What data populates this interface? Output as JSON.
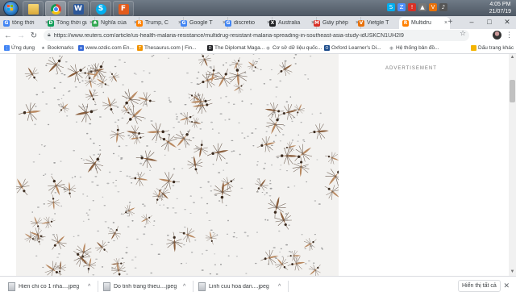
{
  "taskbar": {
    "apps": [
      {
        "icon": "folder-icon",
        "label": ""
      },
      {
        "icon": "chrome-icon",
        "label": ""
      },
      {
        "icon": "word-icon",
        "label": "W"
      },
      {
        "icon": "skype-icon",
        "label": "S"
      },
      {
        "icon": "foxit-reader-icon",
        "label": "F"
      }
    ],
    "clock": {
      "time": "4:05 PM",
      "date": "21/07/19"
    }
  },
  "tabs": [
    {
      "label": "tổng thời",
      "favicon": "translate",
      "color": "#4285f4",
      "active": false
    },
    {
      "label": "Tổng thời gian",
      "favicon": "doc",
      "color": "#0f9d58",
      "active": false
    },
    {
      "label": "Nghĩa của",
      "favicon": "leaf",
      "color": "#34a853",
      "active": false
    },
    {
      "label": "Trump, C",
      "favicon": "reuters",
      "color": "#ff8000",
      "active": false
    },
    {
      "label": "Google T",
      "favicon": "translate",
      "color": "#4285f4",
      "active": false
    },
    {
      "label": "discretio",
      "favicon": "google",
      "color": "#4285f4",
      "active": false
    },
    {
      "label": "Australia",
      "favicon": "x",
      "color": "#202124",
      "active": false
    },
    {
      "label": "Giấy phép",
      "favicon": "gmail",
      "color": "#d93025",
      "active": false
    },
    {
      "label": "Vietgle T",
      "favicon": "v",
      "color": "#e8710a",
      "active": false
    },
    {
      "label": "Multidru",
      "favicon": "reuters",
      "color": "#ff8000",
      "active": true
    }
  ],
  "address_bar": {
    "url": "https://www.reuters.com/article/us-health-malaria-resistance/multidrug-resistant-malaria-spreading-in-southeast-asia-study-idUSKCN1UH2I9"
  },
  "bookmarks": [
    {
      "label": "Ứng dụng",
      "icon": "apps-icon",
      "color": "#4285f4"
    },
    {
      "label": "Bookmarks",
      "icon": "star-icon",
      "color": "#5f6368"
    },
    {
      "label": "www.ozdic.com En...",
      "icon": "ozdic-icon",
      "color": "#3367d6"
    },
    {
      "label": "Thesaurus.com | Fin...",
      "icon": "thesaurus-icon",
      "color": "#f09300"
    },
    {
      "label": "The Diplomat Maga...",
      "icon": "diplomat-icon",
      "color": "#202124"
    },
    {
      "label": "Cơ sở dữ liệu quốc...",
      "icon": "globe-icon",
      "color": "#5f6368"
    },
    {
      "label": "Oxford Learner's Di...",
      "icon": "oxford-icon",
      "color": "#1a4a8a"
    },
    {
      "label": "Hệ thống bản đồ...",
      "icon": "map-icon",
      "color": "#5f6368"
    },
    {
      "label": "Dấu trang khác",
      "icon": "folder-icon",
      "color": "#f4b400"
    }
  ],
  "page": {
    "ad_label": "ADVERTISEMENT",
    "image_alt": "mosquitoes"
  },
  "downloads": {
    "items": [
      {
        "name": "Hien chi co 1 nha....jpeg"
      },
      {
        "name": "Do tinh trang thieu....jpeg"
      },
      {
        "name": "Linh cuu hoa dan....jpeg"
      }
    ],
    "show_all": "Hiển thị tất cả"
  }
}
